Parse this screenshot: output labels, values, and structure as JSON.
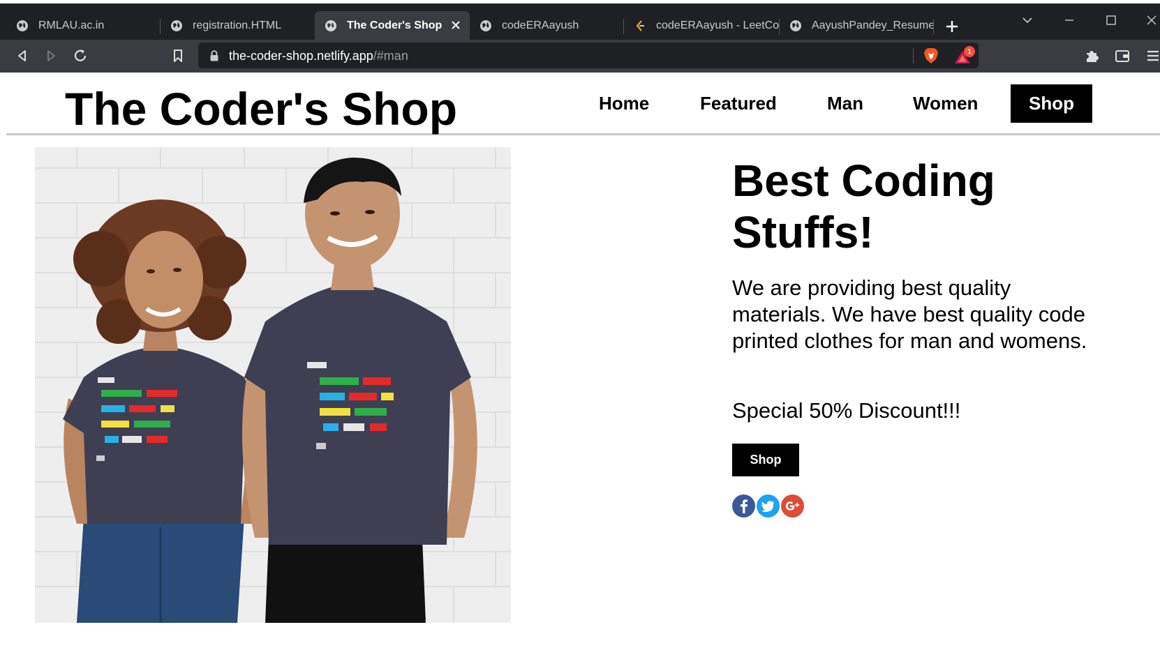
{
  "browser": {
    "tabs": [
      {
        "title": "RMLAU.ac.in"
      },
      {
        "title": "registration.HTML"
      },
      {
        "title": "The Coder's Shop",
        "active": true
      },
      {
        "title": "codeERAayush"
      },
      {
        "title": "codeERAayush - LeetCod"
      },
      {
        "title": "AayushPandey_Resume.p"
      }
    ],
    "address": {
      "host": "the-coder-shop.netlify.app",
      "path": "/#man"
    },
    "notification_count": "1"
  },
  "site": {
    "brand": "The Coder's Shop",
    "nav": [
      "Home",
      "Featured",
      "Man",
      "Women"
    ],
    "nav_cta": "Shop"
  },
  "hero": {
    "title": "Best Coding Stuffs!",
    "description": "We are providing best quality materials. We have best quality code printed clothes for man and womens.",
    "discount": "Special 50% Discount!!!",
    "button": "Shop",
    "social": [
      "facebook-icon",
      "twitter-icon",
      "google-plus-icon"
    ]
  },
  "colors": {
    "chrome_dark": "#1f2024",
    "chrome_toolbar": "#3b3c42",
    "facebook": "#3b5998",
    "twitter": "#1da1f2",
    "google_plus": "#dd4b39",
    "shirt": "#3e3f52"
  }
}
